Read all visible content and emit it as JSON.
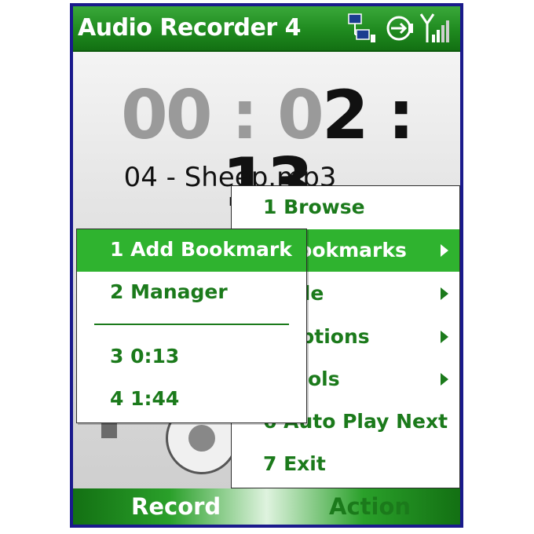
{
  "titlebar": {
    "title": "Audio Recorder 4",
    "icons": [
      "network-activity-icon",
      "usb-sync-icon",
      "signal-strength-icon"
    ]
  },
  "player": {
    "timer_dim": "00 : 0",
    "timer_lit": "2 : 13",
    "filename": "04 - Sheep.mp3"
  },
  "main_menu": {
    "items": [
      {
        "label": "1 Browse",
        "has_submenu": false
      },
      {
        "label": "2 Bookmarks",
        "has_submenu": true,
        "selected": true
      },
      {
        "label": "3 File",
        "has_submenu": true
      },
      {
        "label": "4 Options",
        "has_submenu": true
      },
      {
        "label": "5 Tools",
        "has_submenu": true
      },
      {
        "label": "6 Auto Play Next",
        "has_submenu": false
      },
      {
        "label": "7 Exit",
        "has_submenu": false
      }
    ]
  },
  "bookmarks_submenu": {
    "items": [
      {
        "label": "1 Add Bookmark",
        "selected": true
      },
      {
        "label": "2 Manager"
      },
      {
        "label": "3 0:13"
      },
      {
        "label": "4 1:44"
      }
    ]
  },
  "softkeys": {
    "left": "Record",
    "right": "Action"
  },
  "colors": {
    "accent_green": "#1b7a1b",
    "selection_green": "#2fb32f",
    "frame_blue": "#1a1a8c"
  }
}
